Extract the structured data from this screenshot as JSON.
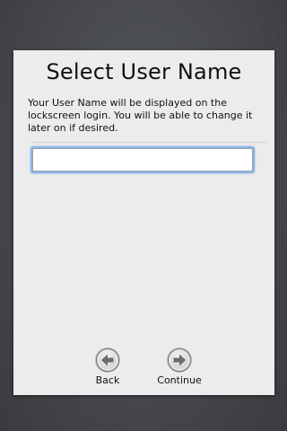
{
  "page": {
    "title": "Select User Name",
    "description": "Your User Name will be displayed on the lockscreen login. You will be able to change it later on if desired."
  },
  "form": {
    "username_value": "",
    "username_placeholder": ""
  },
  "nav": {
    "back_label": "Back",
    "back_icon": "arrow-left-icon",
    "continue_label": "Continue",
    "continue_icon": "arrow-right-icon"
  },
  "colors": {
    "panel_background": "#ececec",
    "page_background": "#4a4c51",
    "input_focus_ring": "#8ab4e6",
    "arrow_fill": "#6b6b6b"
  }
}
